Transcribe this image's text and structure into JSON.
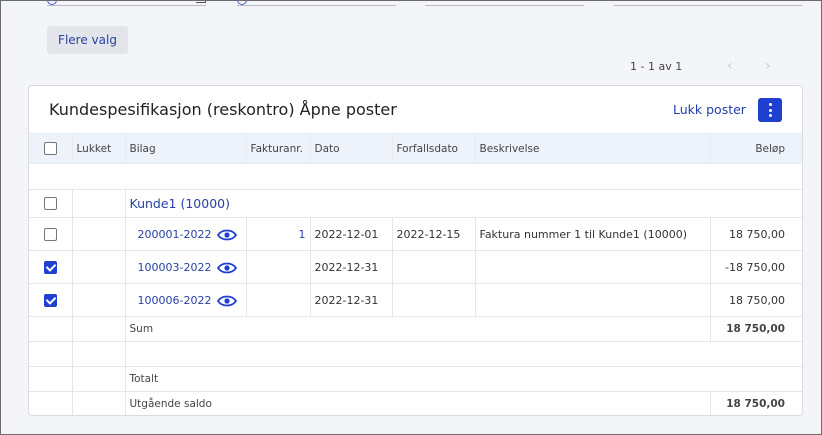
{
  "toolbar": {
    "more_options_label": "Flere valg"
  },
  "pagination": {
    "range_text": "1 - 1 av 1",
    "prev_icon": "chevron-left-icon",
    "next_icon": "chevron-right-icon"
  },
  "card": {
    "title": "Kundespesifikasjon (reskontro) Åpne poster",
    "close_items_label": "Lukk poster",
    "menu_icon": "more-vertical-icon"
  },
  "table": {
    "columns": {
      "closed": "Lukket",
      "voucher": "Bilag",
      "invoice_no": "Fakturanr.",
      "date": "Dato",
      "due_date": "Forfallsdato",
      "description": "Beskrivelse",
      "amount": "Beløp"
    },
    "group": {
      "label": "Kunde1 (10000)"
    },
    "rows": [
      {
        "checked": false,
        "voucher": "200001-2022",
        "invoice_no": "1",
        "date": "2022-12-01",
        "due_date": "2022-12-15",
        "description": "Faktura nummer 1 til Kunde1 (10000)",
        "amount": "18 750,00"
      },
      {
        "checked": true,
        "voucher": "100003-2022",
        "invoice_no": "",
        "date": "2022-12-31",
        "due_date": "",
        "description": "",
        "amount": "-18 750,00"
      },
      {
        "checked": true,
        "voucher": "100006-2022",
        "invoice_no": "",
        "date": "2022-12-31",
        "due_date": "",
        "description": "",
        "amount": "18 750,00"
      }
    ],
    "sum": {
      "label": "Sum",
      "amount": "18 750,00"
    },
    "total": {
      "label": "Totalt"
    },
    "closing": {
      "label": "Utgående saldo",
      "amount": "18 750,00"
    }
  },
  "colors": {
    "accent": "#1f3fd0",
    "link": "#2942a4",
    "header_bg": "#eef2fa",
    "page_bg": "#f4f5f8"
  }
}
